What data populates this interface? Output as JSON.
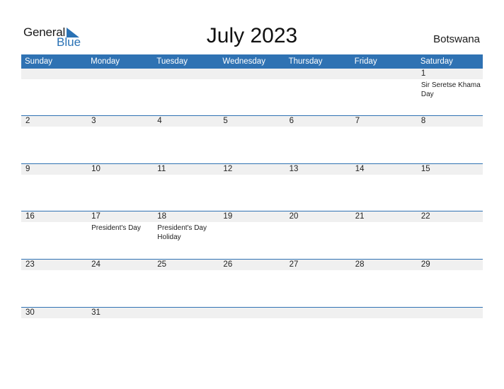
{
  "logo": {
    "line1": "General",
    "line2": "Blue"
  },
  "title": "July 2023",
  "country": "Botswana",
  "colors": {
    "accent": "#2f72b3",
    "strip": "#f0f0f0"
  },
  "days": [
    "Sunday",
    "Monday",
    "Tuesday",
    "Wednesday",
    "Thursday",
    "Friday",
    "Saturday"
  ],
  "weeks": [
    [
      {
        "d": ""
      },
      {
        "d": ""
      },
      {
        "d": ""
      },
      {
        "d": ""
      },
      {
        "d": ""
      },
      {
        "d": ""
      },
      {
        "d": "1",
        "ev": "Sir Seretse Khama Day"
      }
    ],
    [
      {
        "d": "2"
      },
      {
        "d": "3"
      },
      {
        "d": "4"
      },
      {
        "d": "5"
      },
      {
        "d": "6"
      },
      {
        "d": "7"
      },
      {
        "d": "8"
      }
    ],
    [
      {
        "d": "9"
      },
      {
        "d": "10"
      },
      {
        "d": "11"
      },
      {
        "d": "12"
      },
      {
        "d": "13"
      },
      {
        "d": "14"
      },
      {
        "d": "15"
      }
    ],
    [
      {
        "d": "16"
      },
      {
        "d": "17",
        "ev": "President's Day"
      },
      {
        "d": "18",
        "ev": "President's Day Holiday"
      },
      {
        "d": "19"
      },
      {
        "d": "20"
      },
      {
        "d": "21"
      },
      {
        "d": "22"
      }
    ],
    [
      {
        "d": "23"
      },
      {
        "d": "24"
      },
      {
        "d": "25"
      },
      {
        "d": "26"
      },
      {
        "d": "27"
      },
      {
        "d": "28"
      },
      {
        "d": "29"
      }
    ],
    [
      {
        "d": "30"
      },
      {
        "d": "31"
      },
      {
        "d": ""
      },
      {
        "d": ""
      },
      {
        "d": ""
      },
      {
        "d": ""
      },
      {
        "d": ""
      }
    ]
  ]
}
